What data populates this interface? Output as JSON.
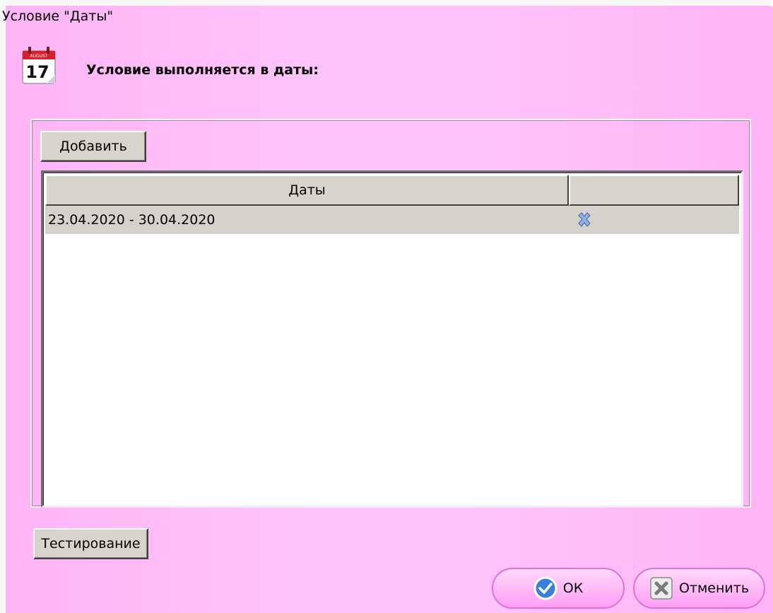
{
  "window": {
    "title": "Условие \"Даты\"",
    "heading": "Условие выполняется в даты:"
  },
  "calendar_icon": {
    "month": "AUGUST",
    "day": "17"
  },
  "buttons": {
    "add": "Добавить",
    "test": "Тестирование",
    "ok": "ОК",
    "cancel": "Отменить"
  },
  "table": {
    "columns": [
      "Даты",
      ""
    ],
    "rows": [
      {
        "dates": "23.04.2020 - 30.04.2020"
      }
    ]
  },
  "colors": {
    "background": "#ffc4fb",
    "button_face": "#d9d4cb",
    "row_bg": "#d6d2cb"
  }
}
